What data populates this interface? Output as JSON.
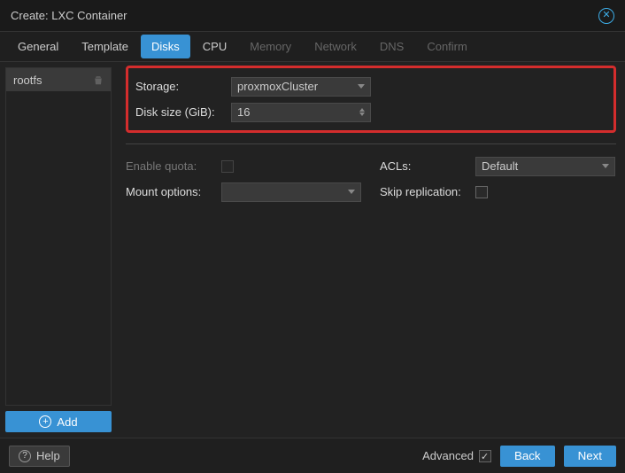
{
  "title": "Create: LXC Container",
  "tabs": [
    {
      "label": "General",
      "state": "enabled"
    },
    {
      "label": "Template",
      "state": "enabled"
    },
    {
      "label": "Disks",
      "state": "active"
    },
    {
      "label": "CPU",
      "state": "enabled"
    },
    {
      "label": "Memory",
      "state": "disabled"
    },
    {
      "label": "Network",
      "state": "disabled"
    },
    {
      "label": "DNS",
      "state": "disabled"
    },
    {
      "label": "Confirm",
      "state": "disabled"
    }
  ],
  "sidebar": {
    "item": "rootfs",
    "add_label": "Add"
  },
  "form": {
    "storage_label": "Storage:",
    "storage_value": "proxmoxCluster",
    "disksize_label": "Disk size (GiB):",
    "disksize_value": "16",
    "enable_quota_label": "Enable quota:",
    "mount_options_label": "Mount options:",
    "mount_options_value": "",
    "acls_label": "ACLs:",
    "acls_value": "Default",
    "skip_replication_label": "Skip replication:"
  },
  "footer": {
    "help_label": "Help",
    "advanced_label": "Advanced",
    "back_label": "Back",
    "next_label": "Next"
  }
}
